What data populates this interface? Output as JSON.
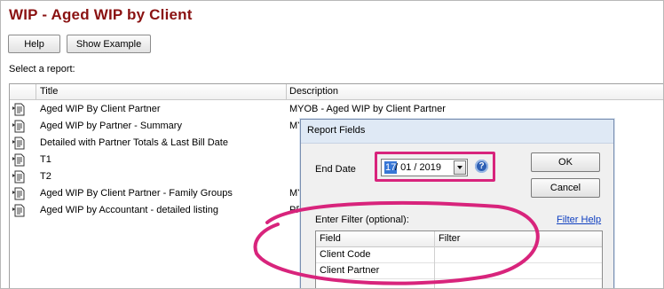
{
  "page": {
    "title": "WIP - Aged WIP by Client",
    "buttons": {
      "help": "Help",
      "show_example": "Show Example"
    },
    "select_label": "Select a report:"
  },
  "report_list": {
    "columns": {
      "title": "Title",
      "description": "Description"
    },
    "rows": [
      {
        "title": "Aged WIP By Client Partner",
        "description": "MYOB - Aged WIP by Client Partner"
      },
      {
        "title": "Aged WIP by Partner - Summary",
        "description": "MY"
      },
      {
        "title": "Detailed with Partner Totals & Last Bill Date",
        "description": ""
      },
      {
        "title": "T1",
        "description": ""
      },
      {
        "title": "T2",
        "description": ""
      },
      {
        "title": "Aged WIP By Client Partner - Family Groups",
        "description": "MY"
      },
      {
        "title": "Aged WIP by Accountant - detailed listing",
        "description": "PF"
      }
    ],
    "row_icon": "report-document-icon"
  },
  "dialog": {
    "title": "Report Fields",
    "end_date_label": "End Date",
    "end_date_selected": "17",
    "end_date_rest": "/ 01 / 2019",
    "ok": "OK",
    "cancel": "Cancel",
    "filter_label": "Enter Filter (optional):",
    "filter_help": "Filter Help",
    "filter_columns": {
      "field": "Field",
      "filter": "Filter"
    },
    "filter_rows": [
      {
        "field": "Client Code",
        "filter": ""
      },
      {
        "field": "Client Partner",
        "filter": ""
      }
    ]
  },
  "colors": {
    "title": "#8a1212",
    "highlight": "#d8247c",
    "link": "#0f3fc0",
    "selection": "#3877d6"
  }
}
